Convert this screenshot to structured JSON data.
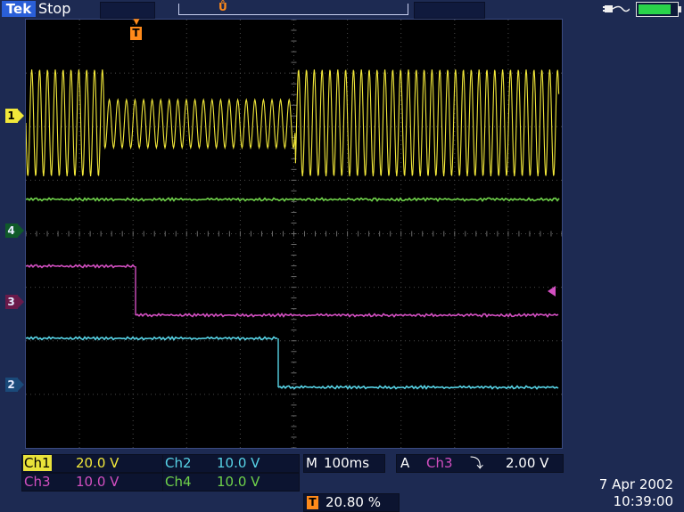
{
  "brand": "Tek",
  "run_status": "Stop",
  "trigger_marker_label": "T",
  "channels": {
    "ch1": {
      "marker": "1",
      "label": "Ch1",
      "scale": "20.0 V",
      "color": "#f2e83a"
    },
    "ch2": {
      "marker": "2",
      "label": "Ch2",
      "scale": "10.0 V",
      "color": "#57d3e6"
    },
    "ch3": {
      "marker": "3",
      "label": "Ch3",
      "scale": "10.0 V",
      "color": "#d24fc0"
    },
    "ch4": {
      "marker": "4",
      "label": "Ch4",
      "scale": "10.0 V",
      "color": "#6fd24a"
    }
  },
  "timebase": {
    "prefix": "M",
    "value": "100ms"
  },
  "trigger": {
    "prefix": "A",
    "source": "Ch3",
    "slope_icon": "falling-edge-icon",
    "slope_glyph": "⤵",
    "level": "2.00 V"
  },
  "trigger_position": {
    "icon": "trigger-icon",
    "glyph": "T",
    "value": "20.80 %"
  },
  "date": "7 Apr 2002",
  "time": "10:39:00",
  "power_icon": "ac-plug-icon",
  "battery_icon": "battery-icon"
}
